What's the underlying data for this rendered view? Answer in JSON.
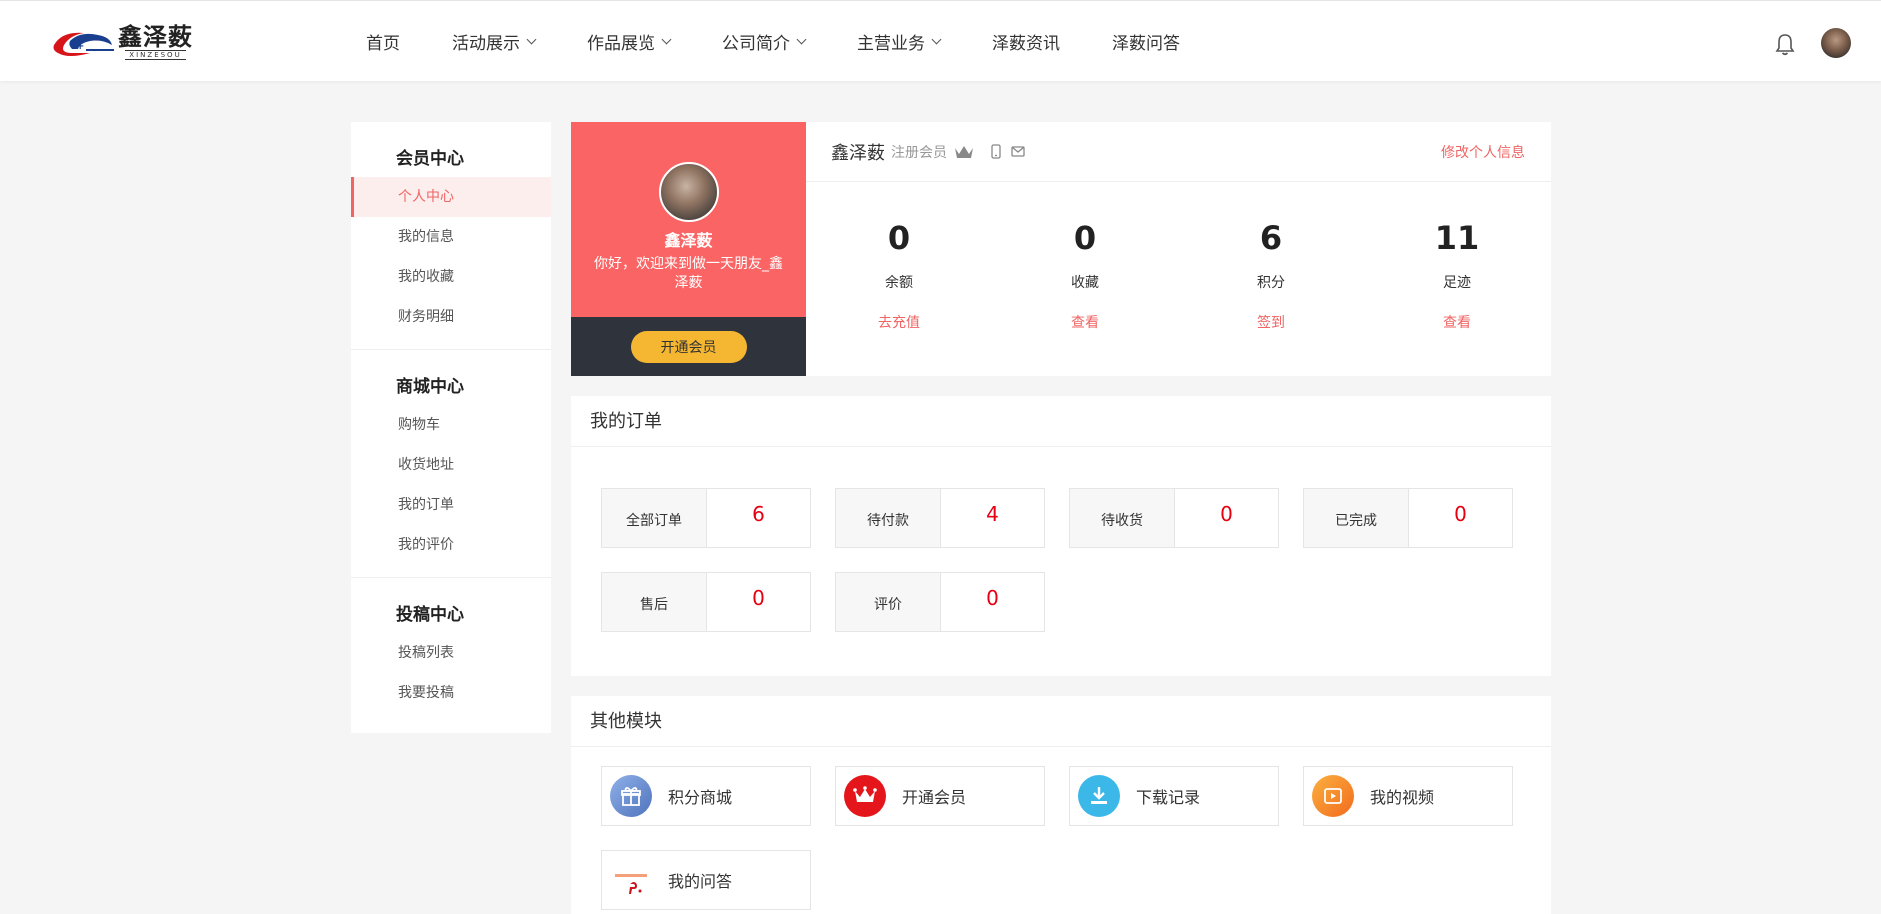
{
  "header": {
    "logo_cn": "鑫泽薮",
    "logo_en": "XINZESOU",
    "nav": [
      {
        "label": "首页",
        "dropdown": false
      },
      {
        "label": "活动展示",
        "dropdown": true
      },
      {
        "label": "作品展览",
        "dropdown": true
      },
      {
        "label": "公司简介",
        "dropdown": true
      },
      {
        "label": "主营业务",
        "dropdown": true
      },
      {
        "label": "泽薮资讯",
        "dropdown": false
      },
      {
        "label": "泽薮问答",
        "dropdown": false
      }
    ]
  },
  "sidebar": {
    "groups": [
      {
        "title": "会员中心",
        "items": [
          "个人中心",
          "我的信息",
          "我的收藏",
          "财务明细"
        ]
      },
      {
        "title": "商城中心",
        "items": [
          "购物车",
          "收货地址",
          "我的订单",
          "我的评价"
        ]
      },
      {
        "title": "投稿中心",
        "items": [
          "投稿列表",
          "我要投稿"
        ]
      }
    ],
    "active": "个人中心"
  },
  "profile": {
    "name": "鑫泽薮",
    "greeting": "你好，欢迎来到做一天朋友_鑫泽薮",
    "vip_button": "开通会员",
    "level": "注册会员",
    "edit_link": "修改个人信息",
    "stats": [
      {
        "value": "0",
        "label": "余额",
        "link": "去充值"
      },
      {
        "value": "0",
        "label": "收藏",
        "link": "查看"
      },
      {
        "value": "6",
        "label": "积分",
        "link": "签到"
      },
      {
        "value": "11",
        "label": "足迹",
        "link": "查看"
      }
    ]
  },
  "orders": {
    "title": "我的订单",
    "items": [
      {
        "label": "全部订单",
        "count": "6"
      },
      {
        "label": "待付款",
        "count": "4"
      },
      {
        "label": "待收货",
        "count": "0"
      },
      {
        "label": "已完成",
        "count": "0"
      },
      {
        "label": "售后",
        "count": "0"
      },
      {
        "label": "评价",
        "count": "0"
      }
    ],
    "count_color": "#e60012"
  },
  "modules": {
    "title": "其他模块",
    "items": [
      {
        "label": "积分商城",
        "icon": "gift-icon",
        "color": "#6d8fd0"
      },
      {
        "label": "开通会员",
        "icon": "crown-icon",
        "color": "#e4161b"
      },
      {
        "label": "下载记录",
        "icon": "download-icon",
        "color": "#3cb8e8"
      },
      {
        "label": "我的视频",
        "icon": "play-icon",
        "color": "#f7931e"
      },
      {
        "label": "我的问答",
        "icon": "qa-icon",
        "color": "#ffffff"
      }
    ]
  },
  "colors": {
    "accent": "#f06464",
    "profile_red": "#fa6464",
    "profile_dark": "#2f333b",
    "vip_yellow": "#f5b731"
  }
}
